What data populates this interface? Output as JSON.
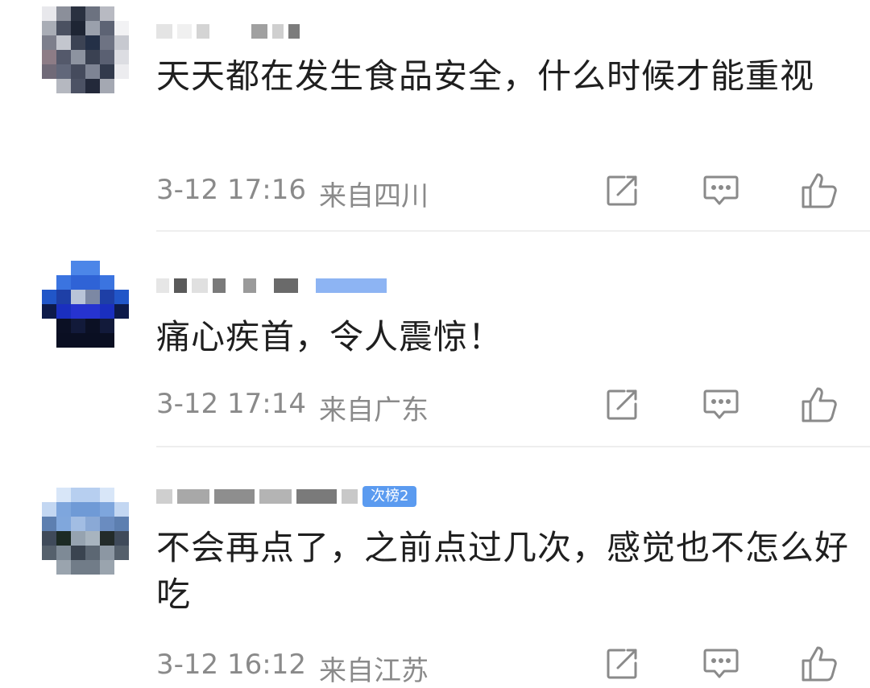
{
  "comments": [
    {
      "text": "天天都在发生食品安全，什么时候才能重视",
      "date": "3-12 17:16",
      "location": "来自四川"
    },
    {
      "text": "痛心疾首，令人震惊！",
      "date": "3-12 17:14",
      "location": "来自广东"
    },
    {
      "text": "不会再点了，之前点过几次，感觉也不怎么好吃",
      "date": "3-12 16:12",
      "location": "来自江苏",
      "badge": "次榜2"
    }
  ],
  "icons": {
    "share": "share-icon",
    "reply": "comment-icon",
    "like": "thumbs-up-icon"
  },
  "colors": {
    "text": "#1f1f1f",
    "meta": "#8a8a8a",
    "icon": "#8a8a8a",
    "divider": "#eeeeee",
    "badge": "#5b9bf0"
  }
}
